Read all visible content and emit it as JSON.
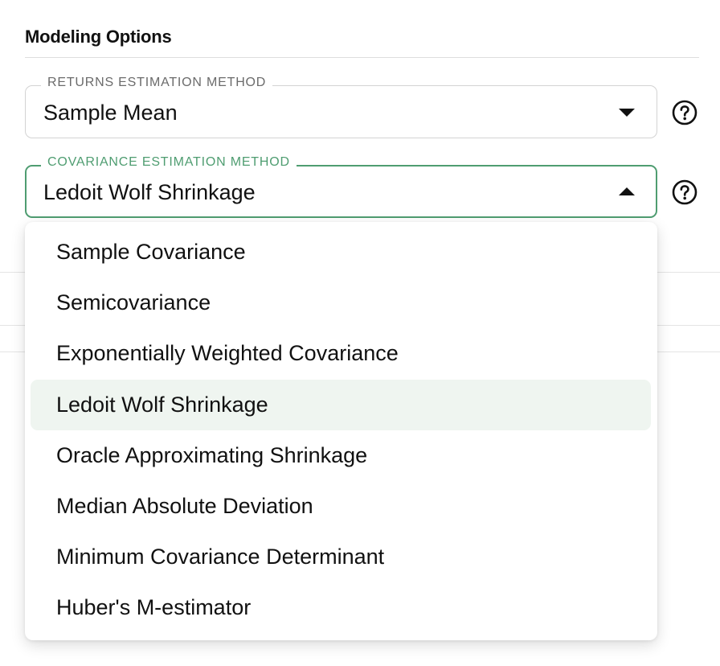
{
  "section": {
    "title": "Modeling Options"
  },
  "returns": {
    "label": "RETURNS ESTIMATION METHOD",
    "value": "Sample Mean"
  },
  "covariance": {
    "label": "COVARIANCE ESTIMATION METHOD",
    "value": "Ledoit Wolf Shrinkage",
    "options": [
      "Sample Covariance",
      "Semicovariance",
      "Exponentially Weighted Covariance",
      "Ledoit Wolf Shrinkage",
      "Oracle Approximating Shrinkage",
      "Median Absolute Deviation",
      "Minimum Covariance Determinant",
      "Huber's M-estimator"
    ],
    "selected_index": 3
  },
  "icons": {
    "help": "help-circle-icon",
    "dropdown_closed": "caret-down-icon",
    "dropdown_open": "caret-up-icon"
  },
  "colors": {
    "focus_accent": "#4f9d71",
    "selected_item_bg": "#eff5f0"
  }
}
